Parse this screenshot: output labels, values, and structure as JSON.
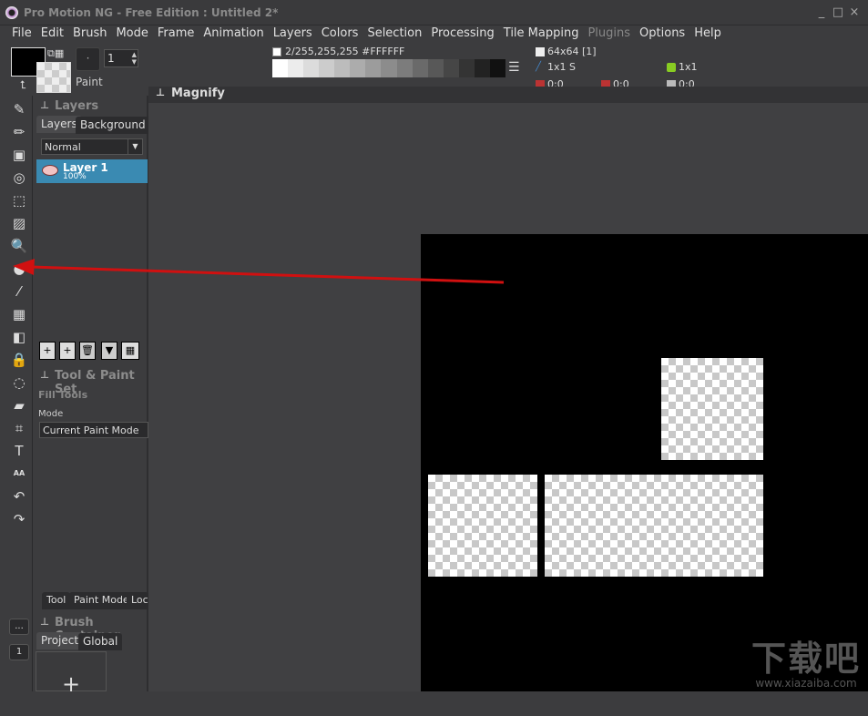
{
  "window": {
    "title": "Pro Motion NG - Free Edition : Untitled 2*",
    "minimize": "_",
    "maximize": "□",
    "close": "×"
  },
  "menu": [
    "File",
    "Edit",
    "Brush",
    "Mode",
    "Frame",
    "Animation",
    "Layers",
    "Colors",
    "Selection",
    "Processing",
    "Tile Mapping",
    "Plugins",
    "Options",
    "Help"
  ],
  "menu_disabled": [
    "Plugins"
  ],
  "toolbar": {
    "brush_dot": "·",
    "brush_size": "1",
    "paint_label": "Paint",
    "color_info": "2/255,255,255 #FFFFFF",
    "grid_info": "64x64 [1]",
    "brush_info": "1x1 S",
    "tile_info": "1x1",
    "coord1": "0:0",
    "coord2": "0:0",
    "coord3": "0:0"
  },
  "palette": [
    "#ffffff",
    "#ececec",
    "#dcdcdc",
    "#cccccc",
    "#bcbcbc",
    "#acacac",
    "#9c9c9c",
    "#8c8c8c",
    "#7c7c7c",
    "#6a6a6a",
    "#585858",
    "#464646",
    "#343434",
    "#222222",
    "#111111"
  ],
  "tools": [
    "spray",
    "pencil",
    "rectangle",
    "circle",
    "brush-select",
    "fill",
    "magnify",
    "eraser-blob",
    "eyedropper",
    "grid",
    "face-stencil",
    "lock",
    "lasso",
    "eraser",
    "crop",
    "text",
    "anti-alias",
    "undo",
    "redo"
  ],
  "layers_panel": {
    "title": "Layers",
    "tabs": [
      "Layers",
      "Background"
    ],
    "blend_mode": "Normal",
    "layer": {
      "name": "Layer 1",
      "opacity": "100%"
    }
  },
  "tool_panel": {
    "title": "Tool & Paint Set",
    "section": "Fill Tools",
    "mode_label": "Mode",
    "mode_value": "Current Paint Mode",
    "tabs": [
      "Tool",
      "Paint Mode",
      "Lock"
    ]
  },
  "brush_panel": {
    "title": "Brush Container",
    "tabs": [
      "Project",
      "Global"
    ],
    "add": "+"
  },
  "side_buttons": {
    "more": "...",
    "frame": "1"
  },
  "magnify": {
    "title": "Magnify"
  },
  "colors": {
    "layer_selected": "#3a8ab2",
    "arrow": "#d01010"
  },
  "watermark": {
    "logo": "下载吧",
    "url": "www.xiazaiba.com"
  }
}
